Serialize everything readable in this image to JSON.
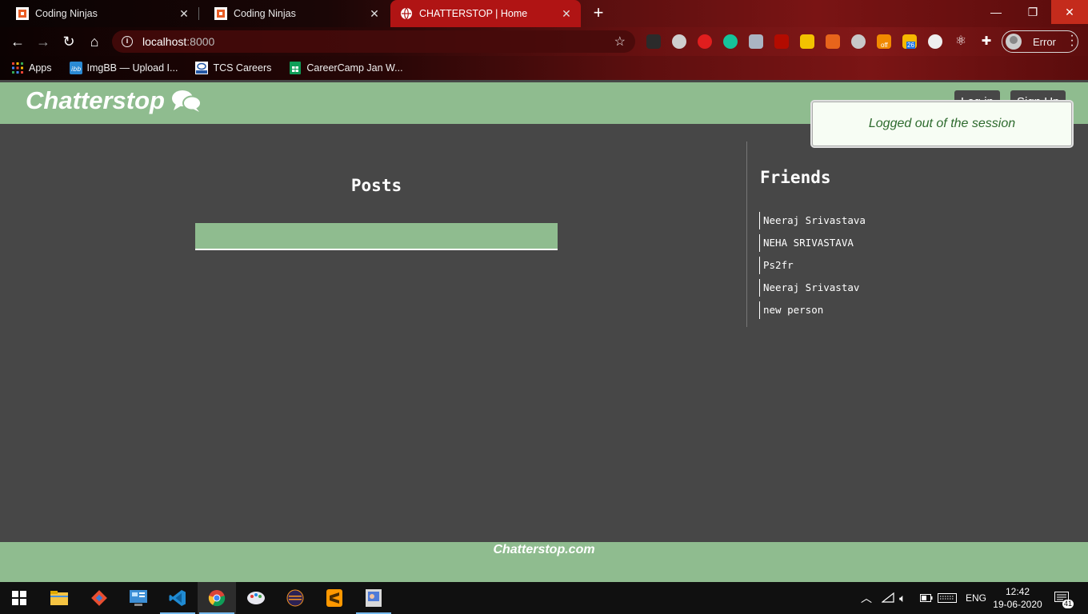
{
  "browser": {
    "tabs": [
      {
        "title": "Coding Ninjas",
        "active": false
      },
      {
        "title": "Coding Ninjas",
        "active": false
      },
      {
        "title": "CHATTERSTOP | Home",
        "active": true
      }
    ],
    "url_host": "localhost",
    "url_port": ":8000",
    "profile_label": "Error",
    "notification_counts": {
      "off_badge": "off",
      "calendar_badge": "26"
    },
    "bookmarks": [
      {
        "label": "Apps",
        "icon": "apps-grid-icon"
      },
      {
        "label": "ImgBB — Upload I...",
        "icon": "imgbb-icon"
      },
      {
        "label": "TCS Careers",
        "icon": "tata-icon"
      },
      {
        "label": "CareerCamp Jan W...",
        "icon": "sheets-icon"
      }
    ]
  },
  "site": {
    "brand": "Chatterstop",
    "login_label": "Log in",
    "signup_label": "Sign Up",
    "toast_message": "Logged out of the session",
    "posts_title": "Posts",
    "friends_title": "Friends",
    "friends": [
      "Neeraj Srivastava",
      "NEHA SRIVASTAVA",
      "Ps2fr",
      "Neeraj Srivastav",
      "new person"
    ],
    "footer_text": "Chatterstop.com"
  },
  "taskbar": {
    "language": "ENG",
    "time": "12:42",
    "date": "19-06-2020",
    "notifications": "41"
  },
  "colors": {
    "header_green": "#8fbc8f",
    "page_bg": "#474747",
    "active_tab": "#b01414"
  }
}
